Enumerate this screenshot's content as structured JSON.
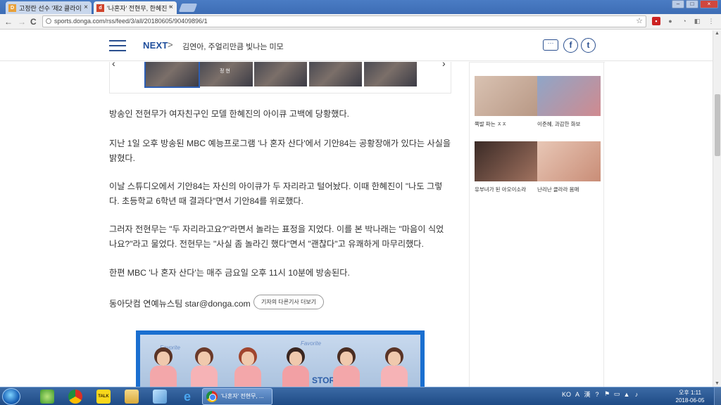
{
  "browser": {
    "tabs": [
      {
        "title": "고정란 선수 '제2 클라이",
        "favicon": "D"
      },
      {
        "title": "'나혼자' 전현무, 한혜진 '",
        "favicon": "d"
      }
    ],
    "url": "sports.donga.com/rss/feed/3/all/20180605/90409896/1",
    "back_icon": "←",
    "forward_icon": "→",
    "reload_icon": "C",
    "star_icon": "☆"
  },
  "site_header": {
    "next_label": "NEXT",
    "next_arrow": ">",
    "next_headline": "김연아, 주얼리만큼 빛나는 미모",
    "comment_icon": "···",
    "facebook_icon": "f",
    "twitter_icon": "t"
  },
  "gallery": {
    "prev": "‹",
    "next": "›",
    "thumb_badge": "정 현"
  },
  "article": {
    "paragraphs": [
      "방송인 전현무가 여자친구인 모델 한혜진의 아이큐 고백에 당황했다.",
      "지난 1일 오후 방송된 MBC 예능프로그램 '나 혼자 산다'에서 기안84는 공황장애가 있다는 사실을 밝혔다.",
      "   이날 스튜디오에서 기안84는 자신의 아이큐가 두 자리라고 털어놨다. 이때 한혜진이 \"나도 그렇다. 초등학교 6학년 때 결과다\"면서 기안84를 위로했다.",
      "그러자 전현무는 \"두 자리라고요?\"라면서 놀라는 표정을 지었다. 이를 본 박나래는 \"마음이 식었나요?\"라고 물었다. 전현무는 \"사실 좀 놀라긴 했다\"면서 \"괜찮다\"고 유쾌하게 마무리했다.",
      "한편 MBC '나 혼자 산다'는 매주 금요일 오후 11시 10분에 방송된다."
    ],
    "byline": "동아닷컴 연예뉴스팀 star@donga.com",
    "more_button": "기자의 다른기사 더보기",
    "photo_banner": [
      "Favorite",
      "Favorite",
      "STOR"
    ]
  },
  "sidebar": {
    "cards": [
      {
        "caption": "쪽발 파는 ㅈㅈ",
        "colors": [
          "#d9c2b2",
          "#b89885"
        ]
      },
      {
        "caption": "이준혜, 과감한 화보",
        "colors": [
          "#8fa6c8",
          "#d08a8f"
        ]
      },
      {
        "caption": "유부녀가 된 아오이소라",
        "colors": [
          "#3a2a26",
          "#a27360"
        ]
      },
      {
        "caption": "난리난 클라라 몸매",
        "colors": [
          "#e8c7b6",
          "#c98d77"
        ]
      }
    ]
  },
  "scrollbar": {
    "up": "▲",
    "down": "▼",
    "position_fraction": 0.2
  },
  "taskbar": {
    "active_task": "'나혼자' 전현무, ...",
    "tray": [
      "KO",
      "A",
      "漢",
      "?",
      "⚑",
      "▭",
      "▲",
      "♪"
    ],
    "time": "오후 1:11",
    "date": "2018-06-05"
  }
}
